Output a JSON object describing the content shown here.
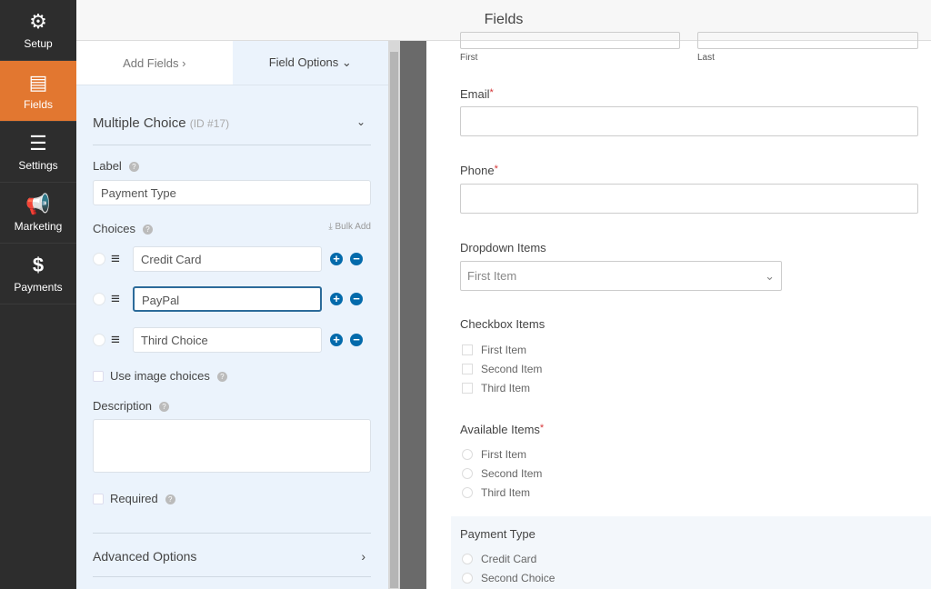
{
  "nav": [
    {
      "label": "Setup",
      "icon": "gear-icon"
    },
    {
      "label": "Fields",
      "icon": "list-icon",
      "active": true
    },
    {
      "label": "Settings",
      "icon": "sliders-icon"
    },
    {
      "label": "Marketing",
      "icon": "megaphone-icon"
    },
    {
      "label": "Payments",
      "icon": "dollar-icon"
    }
  ],
  "header": {
    "title": "Fields"
  },
  "panel": {
    "tabs": [
      "Add Fields ›",
      "Field Options ⌄"
    ],
    "field_title": "Multiple Choice",
    "field_id": "(ID #17)",
    "label_label": "Label",
    "label_value": "Payment Type",
    "choices_label": "Choices",
    "bulk_add": "Bulk Add",
    "choices": [
      "Credit Card",
      "PayPal",
      "Third Choice"
    ],
    "use_image": "Use image choices",
    "description_label": "Description",
    "required_label": "Required",
    "advanced": "Advanced Options"
  },
  "preview": {
    "name_sub": [
      "First",
      "Last"
    ],
    "email": "Email",
    "phone": "Phone",
    "dropdown_label": "Dropdown Items",
    "dropdown_value": "First Item",
    "checkbox_label": "Checkbox Items",
    "checkbox_items": [
      "First Item",
      "Second Item",
      "Third Item"
    ],
    "available_label": "Available Items",
    "available_items": [
      "First Item",
      "Second Item",
      "Third Item"
    ],
    "payment_label": "Payment Type",
    "payment_items": [
      "Credit Card",
      "Second Choice"
    ],
    "required_mark": "*"
  },
  "colors": {
    "accent": "#e27730",
    "focus": "#2c6b9a",
    "action": "#036aab"
  }
}
